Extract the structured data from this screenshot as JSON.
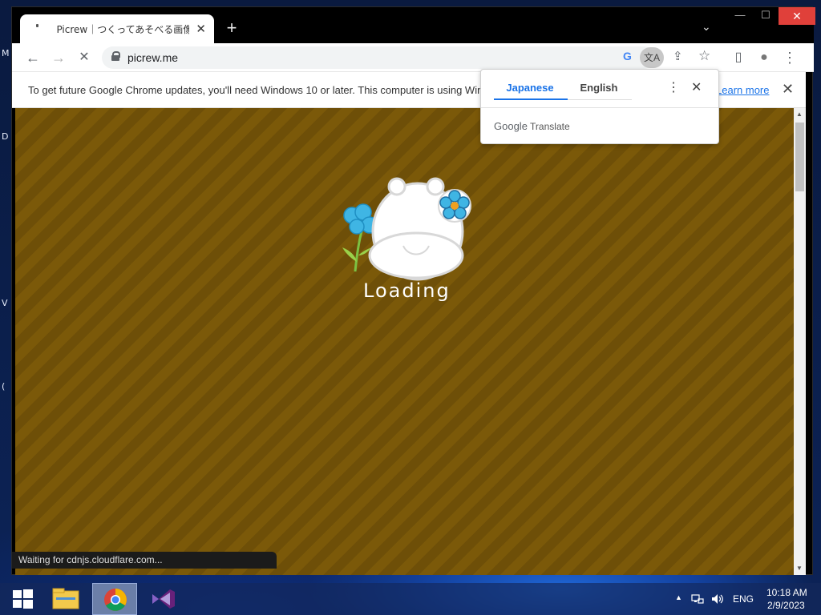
{
  "desktop": {
    "edge_letters": [
      "M",
      "D",
      "V",
      "("
    ]
  },
  "browser": {
    "tab": {
      "title": "Picrew｜つくってあそべる画像メーカー",
      "close_glyph": "✕"
    },
    "new_tab_glyph": "+",
    "tab_search_glyph": "⌄",
    "window_controls": {
      "minimize": "—",
      "maximize": "☐",
      "close": "✕"
    },
    "toolbar": {
      "back": "←",
      "forward": "→",
      "stop": "✕",
      "url": "picrew.me",
      "google_g": "G",
      "translate_chip": "文A",
      "share": "⇪",
      "bookmark": "☆",
      "side_panel": "▯",
      "profile": "●",
      "menu": "⋮"
    },
    "infobar": {
      "message": "To get future Google Chrome updates, you'll need Windows 10 or later. This computer is using Win",
      "link": "Learn more",
      "close": "✕"
    },
    "page": {
      "loading_text": "Loading"
    },
    "status_text": "Waiting for cdnjs.cloudflare.com...",
    "scrollbar": {
      "up": "▲",
      "down": "▼"
    }
  },
  "translate_popup": {
    "tabs": [
      "Japanese",
      "English"
    ],
    "selected_tab": "Japanese",
    "menu": "⋮",
    "close": "✕",
    "footer_brand": "Google",
    "footer_label": "Translate"
  },
  "taskbar": {
    "apps": [
      "start-icon",
      "file-explorer-icon",
      "chrome-icon",
      "visual-studio-icon"
    ],
    "tray": {
      "chevron": "▲",
      "language": "ENG",
      "time": "10:18 AM",
      "date": "2/9/2023"
    }
  },
  "colors": {
    "accent": "#1a73e8",
    "content_background": "#7b5909",
    "close_button": "#e0403a"
  }
}
